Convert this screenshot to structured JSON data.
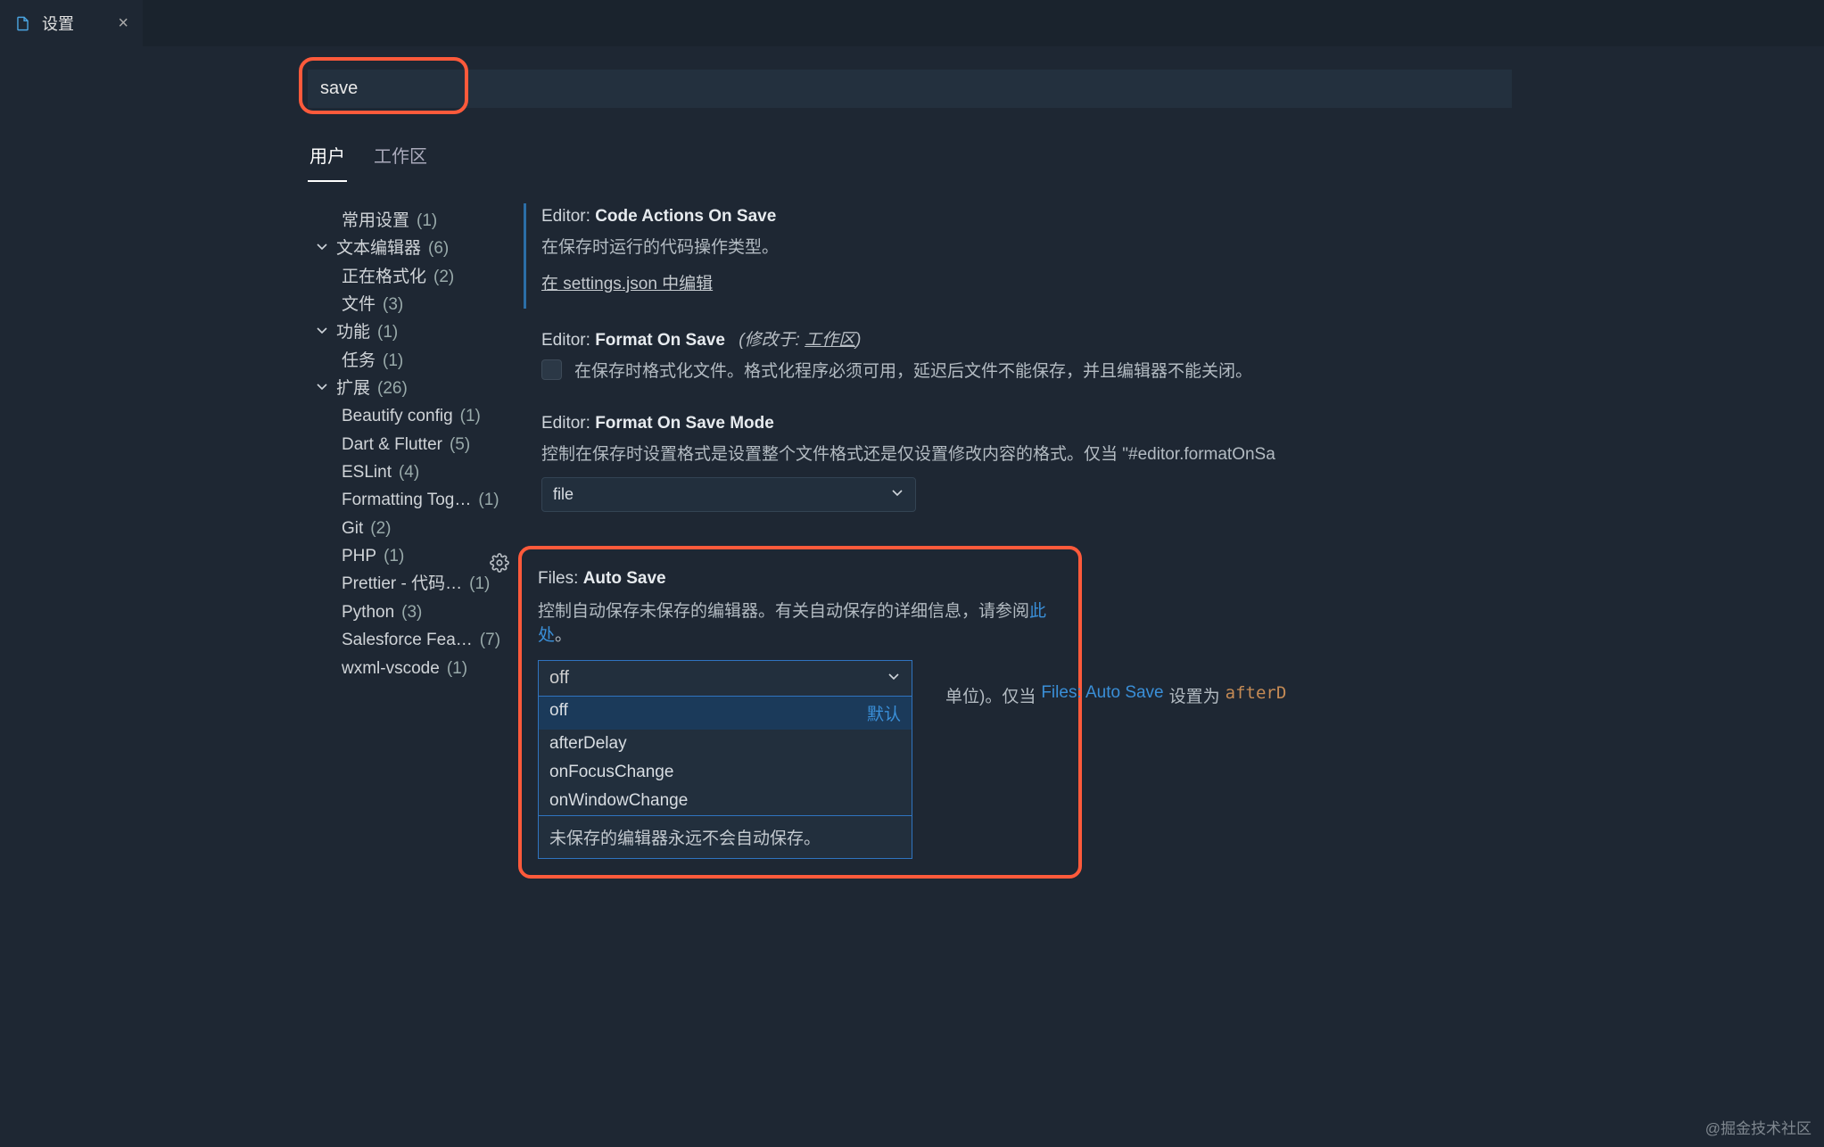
{
  "tab": {
    "title": "设置",
    "icon": "file-icon"
  },
  "search": {
    "value": "save"
  },
  "scopeTabs": {
    "user": "用户",
    "workspace": "工作区"
  },
  "toc": {
    "common": {
      "label": "常用设置",
      "count": "(1)"
    },
    "textEditor": {
      "label": "文本编辑器",
      "count": "(6)"
    },
    "formatting": {
      "label": "正在格式化",
      "count": "(2)"
    },
    "files": {
      "label": "文件",
      "count": "(3)"
    },
    "features": {
      "label": "功能",
      "count": "(1)"
    },
    "tasks": {
      "label": "任务",
      "count": "(1)"
    },
    "extensions": {
      "label": "扩展",
      "count": "(26)"
    },
    "ext1": {
      "label": "Beautify config",
      "count": "(1)"
    },
    "ext2": {
      "label": "Dart & Flutter",
      "count": "(5)"
    },
    "ext3": {
      "label": "ESLint",
      "count": "(4)"
    },
    "ext4": {
      "label": "Formatting Tog…",
      "count": "(1)"
    },
    "ext5": {
      "label": "Git",
      "count": "(2)"
    },
    "ext6": {
      "label": "PHP",
      "count": "(1)"
    },
    "ext7": {
      "label": "Prettier - 代码…",
      "count": "(1)"
    },
    "ext8": {
      "label": "Python",
      "count": "(3)"
    },
    "ext9": {
      "label": "Salesforce Fea…",
      "count": "(7)"
    },
    "ext10": {
      "label": "wxml-vscode",
      "count": "(1)"
    }
  },
  "settings": {
    "codeActionsOnSave": {
      "prefix": "Editor: ",
      "name": "Code Actions On Save",
      "desc": "在保存时运行的代码操作类型。",
      "link": "在 settings.json 中编辑"
    },
    "formatOnSave": {
      "prefix": "Editor: ",
      "name": "Format On Save",
      "modPrefix": "(修改于: ",
      "modLink": "工作区",
      "modSuffix": ")",
      "desc": "在保存时格式化文件。格式化程序必须可用，延迟后文件不能保存，并且编辑器不能关闭。"
    },
    "formatOnSaveMode": {
      "prefix": "Editor: ",
      "name": "Format On Save Mode",
      "desc": "控制在保存时设置格式是设置整个文件格式还是仅设置修改内容的格式。仅当 \"#editor.formatOnSa",
      "value": "file"
    },
    "autoSave": {
      "prefix": "Files: ",
      "name": "Auto Save",
      "descPrefix": "控制自动保存未保存的编辑器。有关自动保存的详细信息，请参阅",
      "descLink": "此处",
      "descSuffix": "。",
      "value": "off",
      "options": [
        "off",
        "afterDelay",
        "onFocusChange",
        "onWindowChange"
      ],
      "defaultLabel": "默认",
      "optionHint": "未保存的编辑器永远不会自动保存。"
    },
    "autoSaveDelay": {
      "partial1": "单位)。仅当 ",
      "partialLink": "Files: Auto Save",
      "partial2": " 设置为",
      "partialCode": "afterD"
    }
  },
  "watermark": "@掘金技术社区"
}
